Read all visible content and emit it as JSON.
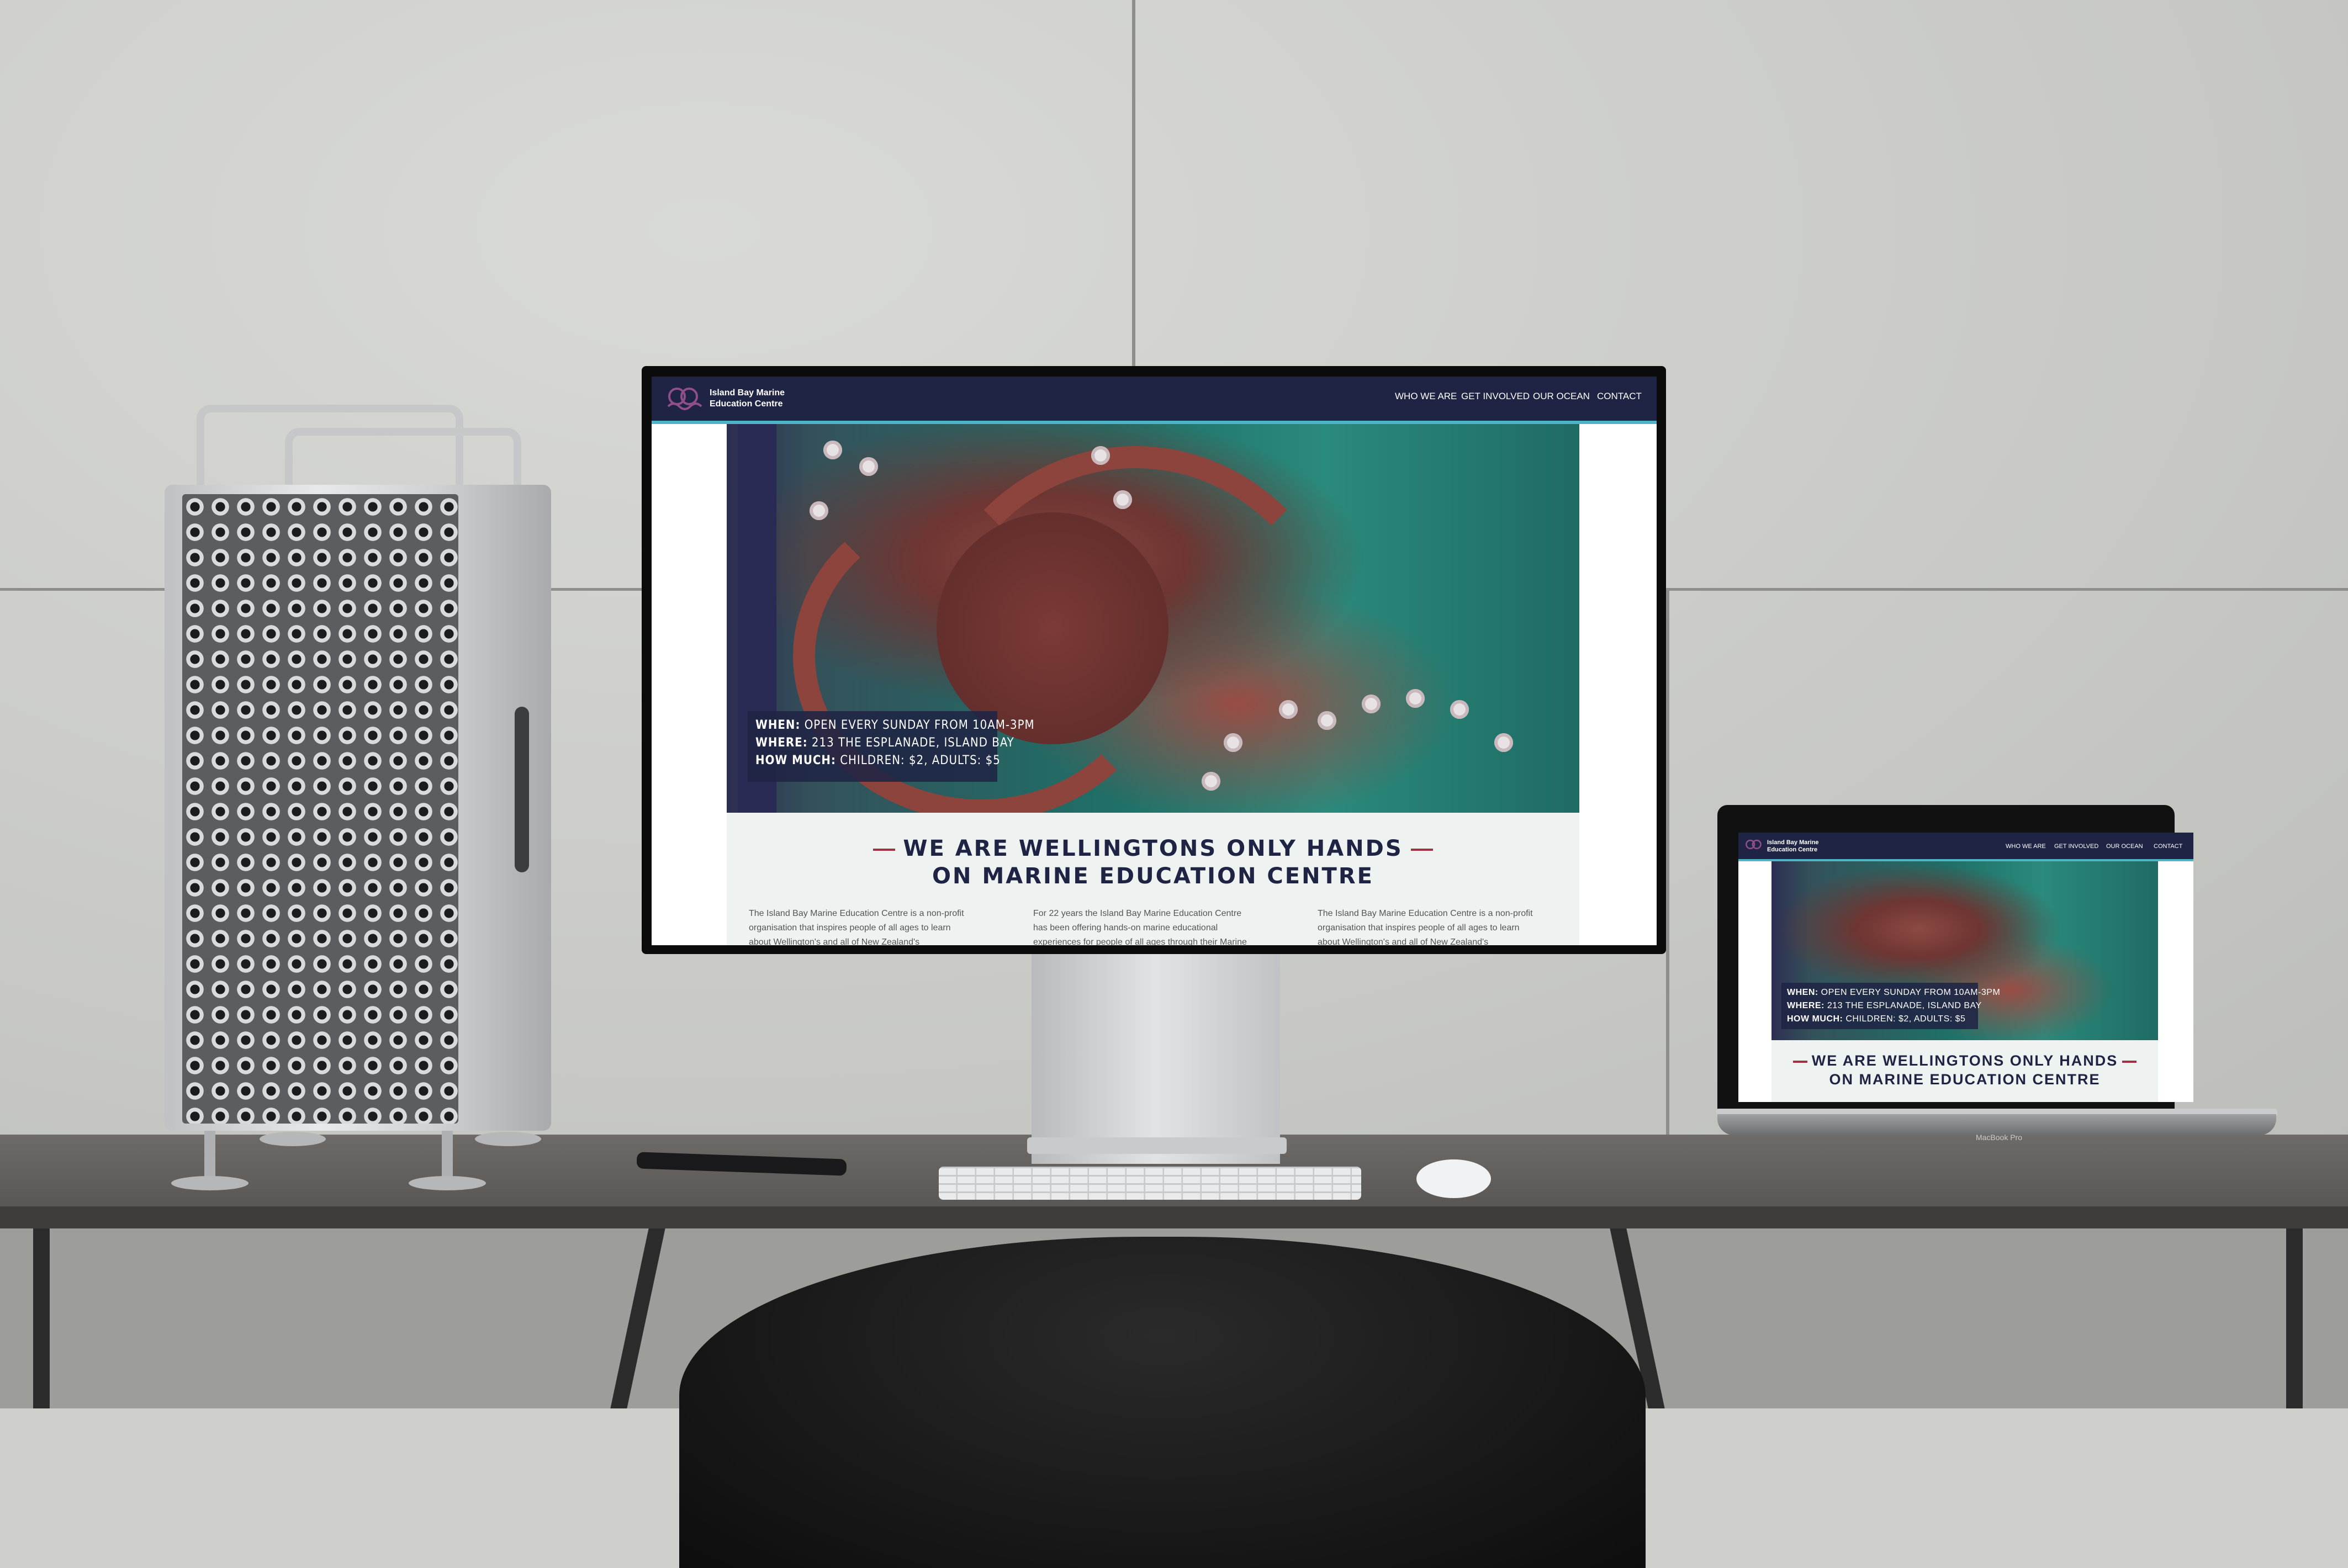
{
  "site": {
    "logo": {
      "line1": "Island Bay Marine",
      "line2": "Education Centre"
    },
    "nav": [
      "WHO WE ARE",
      "GET INVOLVED",
      "OUR OCEAN",
      "CONTACT"
    ],
    "info": {
      "when_label": "WHEN:",
      "when_value": "OPEN EVERY SUNDAY FROM 10AM-3PM",
      "where_label": "WHERE:",
      "where_value": "213 THE ESPLANADE, ISLAND BAY",
      "price_label": "HOW MUCH:",
      "price_value": "CHILDREN: $2, ADULTS: $5"
    },
    "headline": {
      "line1": "WE ARE WELLINGTONS ONLY HANDS",
      "line2": "ON MARINE EDUCATION CENTRE"
    },
    "columns": [
      "The Island Bay Marine Education Centre is a non-profit organisation that inspires people of all ages to learn about Wellington's and all of New Zealand's",
      "For 22 years the Island Bay Marine Education Centre has been offering hands-on marine educational experiences for people of all ages through their Marine",
      "The Island Bay Marine Education Centre is a non-profit organisation that inspires people of all ages to learn about Wellington's and all of New Zealand's"
    ]
  },
  "laptop_label": "MacBook Pro",
  "colors": {
    "navy": "#1f2444",
    "accent_red": "#a03343",
    "accent_teal": "#4fb3c9"
  }
}
